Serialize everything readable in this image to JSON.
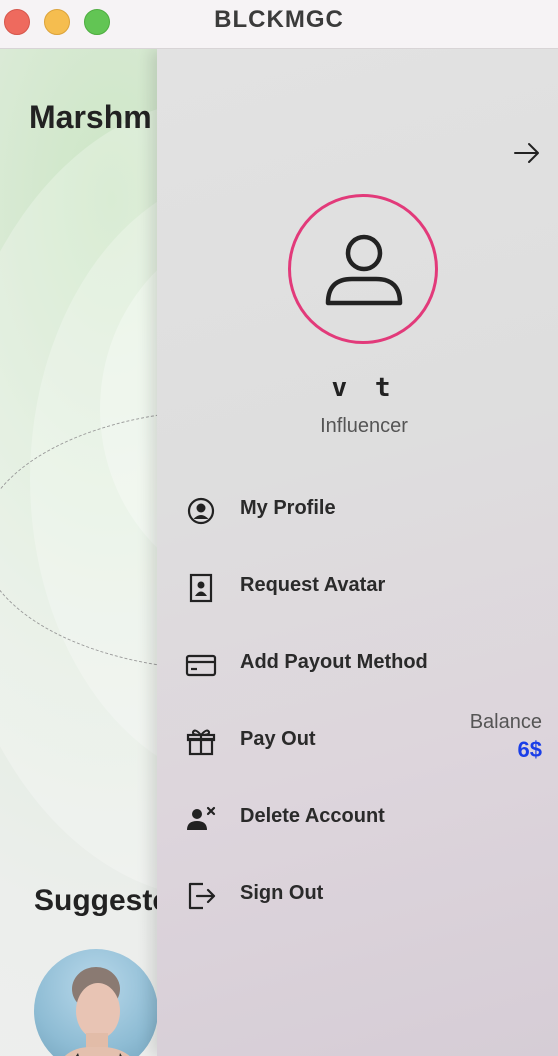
{
  "window": {
    "title": "BLCKMGC"
  },
  "background": {
    "heading_partial": "Marshm",
    "section_partial": "Suggeste"
  },
  "drawer": {
    "close_icon": "arrow-right-icon",
    "user": {
      "name": "v t",
      "role": "Influencer"
    },
    "menu": [
      {
        "label": "My Profile",
        "icon": "user-circle-icon"
      },
      {
        "label": "Request Avatar",
        "icon": "portrait-icon"
      },
      {
        "label": "Add Payout Method",
        "icon": "credit-card-icon"
      },
      {
        "label": "Pay Out",
        "icon": "gift-icon"
      },
      {
        "label": "Delete Account",
        "icon": "user-remove-icon"
      },
      {
        "label": "Sign Out",
        "icon": "sign-out-icon"
      }
    ],
    "balance": {
      "label": "Balance",
      "value": "6$"
    }
  },
  "colors": {
    "accent_ring": "#e23a7a",
    "balance": "#1a3ee8"
  }
}
